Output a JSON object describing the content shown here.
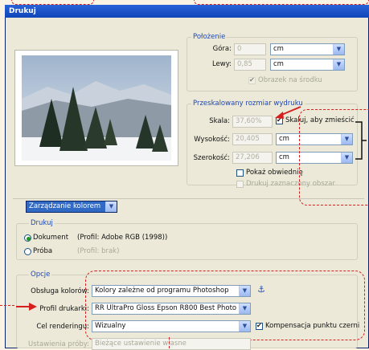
{
  "window": {
    "title": "Drukuj"
  },
  "position": {
    "title": "Położenie",
    "top_label": "Góra:",
    "top_value": "0",
    "top_unit": "cm",
    "left_label": "Lewy:",
    "left_value": "0,85",
    "left_unit": "cm",
    "center_label": "Obrazek na środku"
  },
  "scaled": {
    "title": "Przeskalowany rozmiar wydruku",
    "scale_label": "Skala:",
    "scale_value": "37,60%",
    "fit_label": "Skaluj, aby zmieścić",
    "height_label": "Wysokość:",
    "height_value": "20,405",
    "height_unit": "cm",
    "width_label": "Szerokość:",
    "width_value": "27,206",
    "width_unit": "cm",
    "bounding_label": "Pokaż obwiednię",
    "print_selected_label": "Drukuj zaznaczony obszar"
  },
  "color_mgmt": {
    "select_value": "Zarządzanie kolorem"
  },
  "print_group": {
    "title": "Drukuj",
    "document_label": "Dokument",
    "document_profile": "(Profil: Adobe RGB (1998))",
    "proof_label": "Próba",
    "proof_profile": "(Profil: brak)"
  },
  "options": {
    "title": "Opcje",
    "handling_label": "Obsługa kolorów:",
    "handling_value": "Kolory zależne od programu  Photoshop",
    "printer_profile_label": "Profil drukarki:",
    "printer_profile_value": "RR UltraPro Gloss Epson R800 Best Photo",
    "intent_label": "Cel renderingu:",
    "intent_value": "Wizualny",
    "bpc_label": "Kompensacja punktu czerni",
    "proof_setup_label": "Ustawienia próby:",
    "proof_setup_value": "Bieżące ustawienie własne"
  },
  "colors": {
    "accent": "#1d47b8",
    "annotation": "#d62020",
    "selection": "#316ac5"
  }
}
